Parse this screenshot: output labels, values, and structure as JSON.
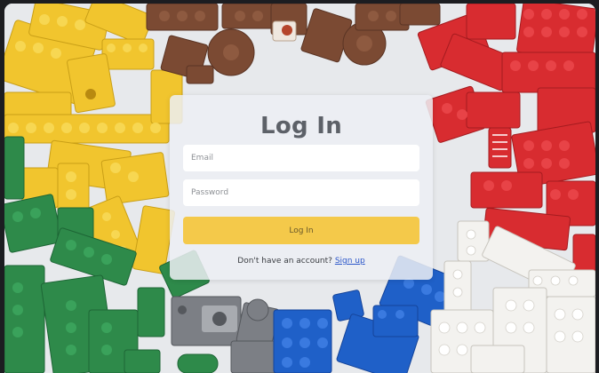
{
  "login": {
    "title": "Log In",
    "email_placeholder": "Email",
    "password_placeholder": "Password",
    "submit_label": "Log In",
    "signup_prompt": "Don't have an account?",
    "signup_link": "Sign up"
  },
  "background": {
    "description_icon": "lego-bricks-background",
    "colors": {
      "yellow": "#f3c62c",
      "brown": "#7a4b35",
      "red": "#d92a2e",
      "green": "#2f8a4b",
      "blue": "#1f5fc8",
      "white": "#f2f1ee",
      "gray": "#7d7f84"
    }
  },
  "accent": {
    "button": "#f4c94a",
    "link": "#2b56c9"
  }
}
